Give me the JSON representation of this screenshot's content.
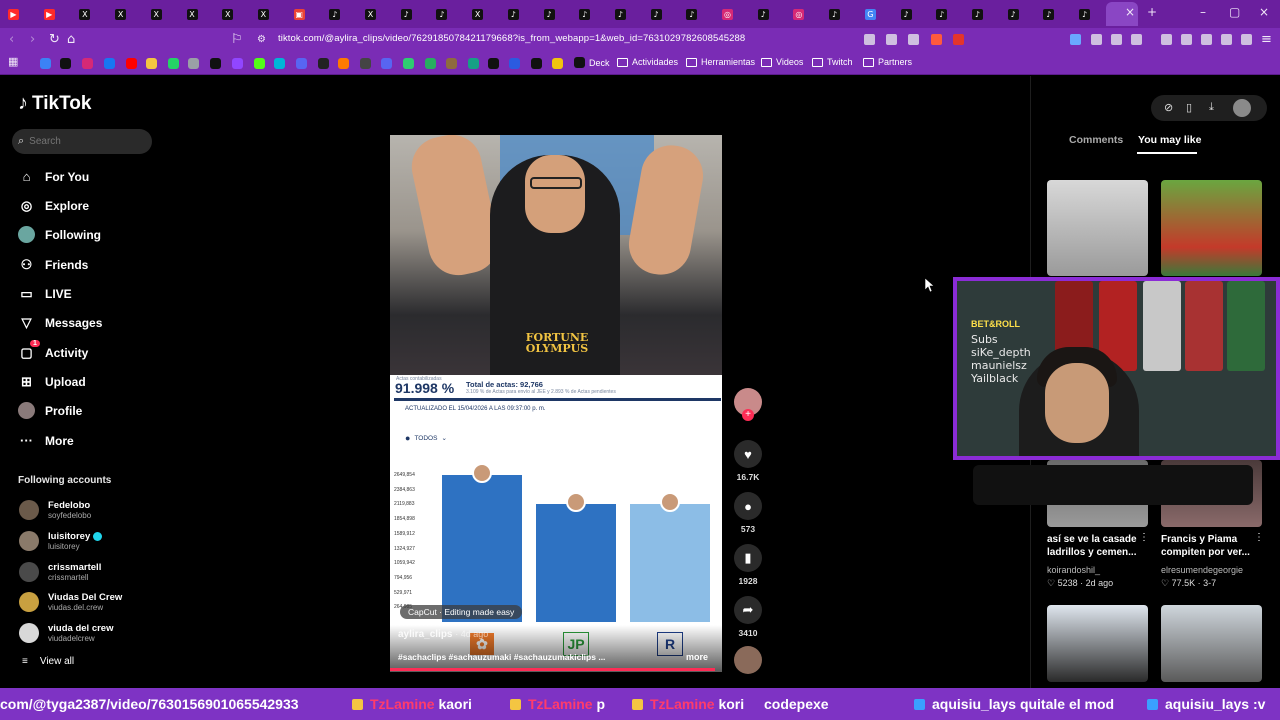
{
  "browser": {
    "url": "tiktok.com/@aylira_clips/video/7629185078421179668?is_from_webapp=1&web_id=7631029782608545288",
    "tabs": [
      {
        "icon": "youtube-icon",
        "color": "#ff2a2a",
        "glyph": "▶"
      },
      {
        "icon": "youtube-icon",
        "color": "#ff2a2a",
        "glyph": "▶"
      },
      {
        "icon": "x-icon",
        "color": "#111111",
        "glyph": "X"
      },
      {
        "icon": "x-icon",
        "color": "#111111",
        "glyph": "X"
      },
      {
        "icon": "x-icon",
        "color": "#111111",
        "glyph": "X"
      },
      {
        "icon": "x-icon",
        "color": "#111111",
        "glyph": "X"
      },
      {
        "icon": "x-icon",
        "color": "#111111",
        "glyph": "X"
      },
      {
        "icon": "x-icon",
        "color": "#111111",
        "glyph": "X"
      },
      {
        "icon": "doc-icon",
        "color": "#ea4335",
        "glyph": "▣"
      },
      {
        "icon": "tiktok-icon",
        "color": "#111111",
        "glyph": "♪"
      },
      {
        "icon": "x-icon",
        "color": "#111111",
        "glyph": "X"
      },
      {
        "icon": "tiktok-icon",
        "color": "#111111",
        "glyph": "♪"
      },
      {
        "icon": "tiktok-icon",
        "color": "#111111",
        "glyph": "♪"
      },
      {
        "icon": "x-icon",
        "color": "#111111",
        "glyph": "X"
      },
      {
        "icon": "tiktok-icon",
        "color": "#111111",
        "glyph": "♪"
      },
      {
        "icon": "tiktok-icon",
        "color": "#111111",
        "glyph": "♪"
      },
      {
        "icon": "tiktok-icon",
        "color": "#111111",
        "glyph": "♪"
      },
      {
        "icon": "tiktok-icon",
        "color": "#111111",
        "glyph": "♪"
      },
      {
        "icon": "tiktok-icon",
        "color": "#111111",
        "glyph": "♪"
      },
      {
        "icon": "tiktok-icon",
        "color": "#111111",
        "glyph": "♪"
      },
      {
        "icon": "instagram-icon",
        "color": "#d62976",
        "glyph": "◎"
      },
      {
        "icon": "tiktok-icon",
        "color": "#111111",
        "glyph": "♪"
      },
      {
        "icon": "instagram-icon",
        "color": "#d62976",
        "glyph": "◎"
      },
      {
        "icon": "tiktok-icon",
        "color": "#111111",
        "glyph": "♪"
      },
      {
        "icon": "google-icon",
        "color": "#4285f4",
        "glyph": "G"
      },
      {
        "icon": "tiktok-icon",
        "color": "#111111",
        "glyph": "♪"
      },
      {
        "icon": "tiktok-icon",
        "color": "#111111",
        "glyph": "♪"
      },
      {
        "icon": "tiktok-icon",
        "color": "#111111",
        "glyph": "♪"
      },
      {
        "icon": "tiktok-icon",
        "color": "#111111",
        "glyph": "♪"
      },
      {
        "icon": "tiktok-icon",
        "color": "#111111",
        "glyph": "♪"
      },
      {
        "icon": "tiktok-icon",
        "color": "#111111",
        "glyph": "♪"
      }
    ],
    "bookmarks": [
      "Deck",
      "Actividades",
      "Herramientas",
      "Videos",
      "Twitch",
      "Partners"
    ]
  },
  "tiktok": {
    "brand": "TikTok",
    "search_placeholder": "Search",
    "nav": [
      {
        "label": "For You",
        "icon": "home-icon",
        "glyph": "⌂"
      },
      {
        "label": "Explore",
        "icon": "compass-icon",
        "glyph": "◎"
      },
      {
        "label": "Following",
        "icon": "following-avatar-icon",
        "glyph": "●"
      },
      {
        "label": "Friends",
        "icon": "friends-icon",
        "glyph": "⚇"
      },
      {
        "label": "LIVE",
        "icon": "live-icon",
        "glyph": "▭"
      },
      {
        "label": "Messages",
        "icon": "messages-icon",
        "glyph": "▽"
      },
      {
        "label": "Activity",
        "icon": "activity-icon",
        "glyph": "▢",
        "badge": "1"
      },
      {
        "label": "Upload",
        "icon": "upload-icon",
        "glyph": "⊞"
      },
      {
        "label": "Profile",
        "icon": "profile-avatar-icon",
        "glyph": "●"
      },
      {
        "label": "More",
        "icon": "more-icon",
        "glyph": "···"
      }
    ],
    "following_title": "Following accounts",
    "accounts": [
      {
        "name": "Fedelobo",
        "user": "soyfedelobo",
        "verified": false,
        "color": "#6b5a4a"
      },
      {
        "name": "luisitorey",
        "user": "luisitorey",
        "verified": true,
        "color": "#8a7a6a"
      },
      {
        "name": "crissmartell",
        "user": "crissmartell",
        "verified": false,
        "color": "#4a4a4a"
      },
      {
        "name": "Viudas Del Crew",
        "user": "viudas.del.crew",
        "verified": false,
        "color": "#c8a040"
      },
      {
        "name": "viuda del crew",
        "user": "viudadelcrew",
        "verified": false,
        "color": "#d8d8d8"
      }
    ],
    "view_all": "View all"
  },
  "video": {
    "overlay_brand": "FORTUNE OLYMPUS",
    "pct": "91.998 %",
    "pct_label": "Actas contabilizadas",
    "total": "Total de actas: 92,766",
    "subtotal": "3.109 % de Actas para envío al JEE y 2.893 % de Actas pendientes",
    "updated": "ACTUALIZADO EL 15/04/2026 A LAS 09:37:00 p. m.",
    "filter": "TODOS",
    "yticks": [
      "2649,854",
      "2384,863",
      "2119,883",
      "1854,898",
      "1589,912",
      "1324,927",
      "1059,942",
      "794,956",
      "529,971",
      "264,985"
    ],
    "chart_data": {
      "type": "bar",
      "values": [
        2649854,
        2119883,
        2119883
      ],
      "ylim": [
        0,
        2649854
      ]
    },
    "capcut": "CapCut · Editing made easy",
    "uploader": "aylira_clips",
    "uploaded": "4d ago",
    "hashtags": "#sachaclips #sachauzumaki #sachauzumakiclips ...",
    "more": "more",
    "progress": 0.98,
    "actions": [
      {
        "icon": "heart-icon",
        "glyph": "♥",
        "count": "16.7K"
      },
      {
        "icon": "comment-icon",
        "glyph": "●",
        "count": "573"
      },
      {
        "icon": "bookmark-icon",
        "glyph": "▮",
        "count": "1928"
      },
      {
        "icon": "share-icon",
        "glyph": "➦",
        "count": "3410"
      }
    ]
  },
  "right": {
    "tabs": [
      "Comments",
      "You may like"
    ],
    "thumbs": [
      {
        "caption": "así se ve la casade ladrillos y cemen...",
        "author": "koirandoshil_",
        "meta": "♡ 5238 · 2d ago"
      },
      {
        "caption": "Francis y Piama compiten por ver...",
        "author": "elresumendegeorgie",
        "meta": "♡ 77.5K · 3-7"
      }
    ]
  },
  "webcam": {
    "brand": "BET&ROLL",
    "overlay": [
      "Subs",
      "siKe_depth",
      "maunielsz",
      "Yailblack"
    ]
  },
  "ticker": {
    "items": [
      {
        "user": "",
        "text": "com/@tyga2387/video/7630156901065542933",
        "color": "#ffffff"
      },
      {
        "user": "TzLamine",
        "text": "kaori",
        "color": "#ff3b6b"
      },
      {
        "user": "TzLamine",
        "text": "p",
        "color": "#ff3b6b"
      },
      {
        "user": "TzLamine",
        "text": "kori",
        "color": "#ff3b6b"
      },
      {
        "user": "codepexe",
        "text": "",
        "color": "#ffffff"
      },
      {
        "user": "aquisiu_lays",
        "text": "quitale el mod",
        "color": "#ffffff"
      },
      {
        "user": "aquisiu_lays",
        "text": ":v",
        "color": "#ffffff"
      }
    ]
  }
}
